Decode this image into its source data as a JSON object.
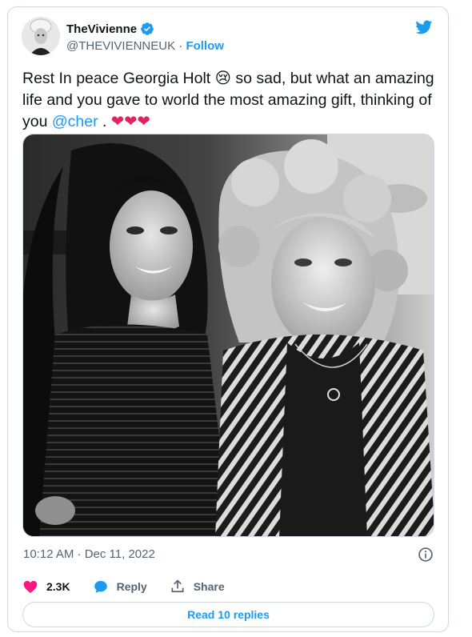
{
  "author": {
    "display_name": "TheVivienne",
    "handle": "@THEVIVIENNEUK",
    "separator": " · ",
    "follow_label": "Follow"
  },
  "tweet": {
    "text_part1": "Rest In peace Georgia Holt ",
    "emoji_cry": "😢",
    "text_part2": " so sad, but what an amazing life and you gave to world the most amazing gift, thinking of you ",
    "mention": "@cher",
    "text_part3": " . ",
    "hearts": "❤❤❤"
  },
  "meta": {
    "timestamp": "10:12 AM · Dec 11, 2022"
  },
  "actions": {
    "like_count": "2.3K",
    "reply_label": "Reply",
    "share_label": "Share"
  },
  "footer": {
    "read_replies_label": "Read 10 replies"
  },
  "colors": {
    "accent": "#1d9bf0",
    "like": "#f91880",
    "muted": "#536471",
    "border": "#cfd9de"
  },
  "icons": [
    "verified-badge-icon",
    "twitter-bird-icon",
    "info-icon",
    "heart-icon",
    "reply-bubble-icon",
    "share-icon"
  ]
}
